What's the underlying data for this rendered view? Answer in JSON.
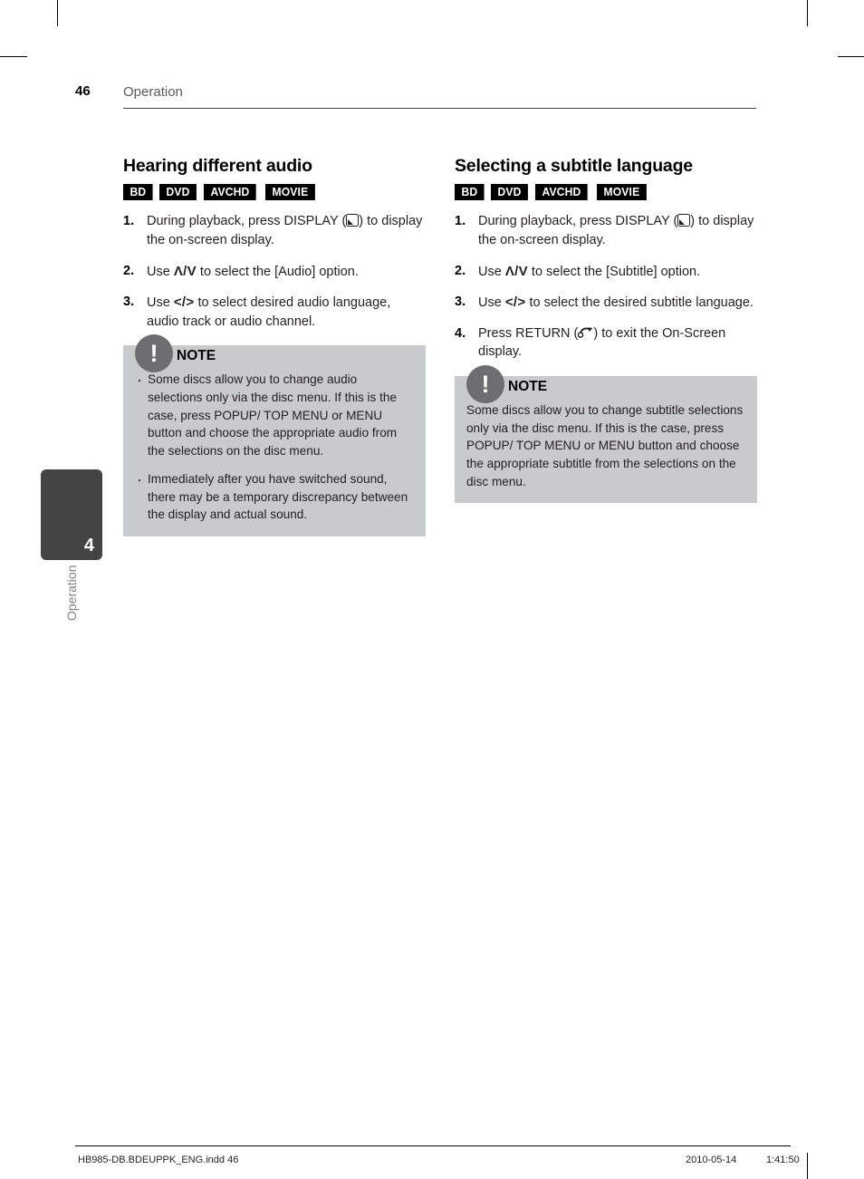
{
  "header": {
    "page_number": "46",
    "title": "Operation"
  },
  "chapter_tab": {
    "number": "4",
    "label": "Operation"
  },
  "columns": [
    {
      "id": "hearing-different-audio",
      "title": "Hearing different audio",
      "badges": [
        "BD",
        "DVD",
        "AVCHD",
        "MOVIE"
      ],
      "steps": [
        {
          "num": "1.",
          "parts": [
            {
              "type": "text",
              "value": "During playback, press DISPLAY ("
            },
            {
              "type": "icon",
              "value": "display-icon"
            },
            {
              "type": "text",
              "value": ") to display the on-screen display."
            }
          ],
          "text_before": "During playback, press DISPLAY (",
          "text_after": ") to display the on-screen display."
        },
        {
          "num": "2.",
          "text_before": "Use ",
          "key": "Λ/V",
          "text_after": " to select the [Audio] option."
        },
        {
          "num": "3.",
          "text_before": "Use ",
          "key": "</>",
          "text_after": " to select desired audio language, audio track or audio channel."
        }
      ],
      "note": {
        "title": "NOTE",
        "icon": "exclamation-icon",
        "bullets": [
          "Some discs allow you to change audio selections only via the disc menu. If this is the case, press POPUP/ TOP MENU or MENU button and choose the appropriate audio from the selections on the disc menu.",
          "Immediately after you have switched sound, there may be a temporary discrepancy between the display and actual sound."
        ]
      }
    },
    {
      "id": "selecting-a-subtitle-language",
      "title": "Selecting a subtitle language",
      "badges": [
        "BD",
        "DVD",
        "AVCHD",
        "MOVIE"
      ],
      "steps": [
        {
          "num": "1.",
          "text_before": "During playback, press DISPLAY (",
          "text_after": ") to display the on-screen display."
        },
        {
          "num": "2.",
          "text_before": "Use ",
          "key": "Λ/V",
          "text_after": " to select the [Subtitle] option."
        },
        {
          "num": "3.",
          "text_before": "Use ",
          "key": "</>",
          "text_after": " to select the desired subtitle language."
        },
        {
          "num": "4.",
          "text_before": "Press RETURN (",
          "text_after": ") to exit the On-Screen display."
        }
      ],
      "note": {
        "title": "NOTE",
        "icon": "exclamation-icon",
        "paragraphs": [
          "Some discs allow you to change subtitle selections only via the disc menu. If this is the case, press POPUP/ TOP MENU or MENU button and choose the appropriate subtitle from the selections on the disc menu."
        ]
      }
    }
  ],
  "note_glyph": "!",
  "footer": {
    "filename": "HB985-DB.BDEUPPK_ENG.indd   46",
    "date": "2010-05-14",
    "time": "1:41:50"
  },
  "colors": {
    "note_background": "#c9cacc",
    "note_circle": "#6d6e71",
    "badge_background": "#000000",
    "chapter_tab": "#434343",
    "header_title": "#58595b"
  }
}
